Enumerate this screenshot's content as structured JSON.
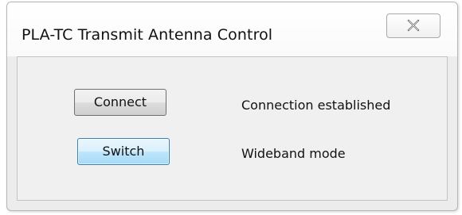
{
  "window": {
    "title": "PLA-TC Transmit Antenna Control",
    "close_icon": "close-x-icon"
  },
  "controls": {
    "connect_label": "Connect",
    "switch_label": "Switch"
  },
  "status": {
    "connection": "Connection established",
    "mode": "Wideband mode"
  },
  "colors": {
    "switch_button_highlight": "#bee6fd",
    "switch_button_border": "#3c7fb1"
  }
}
